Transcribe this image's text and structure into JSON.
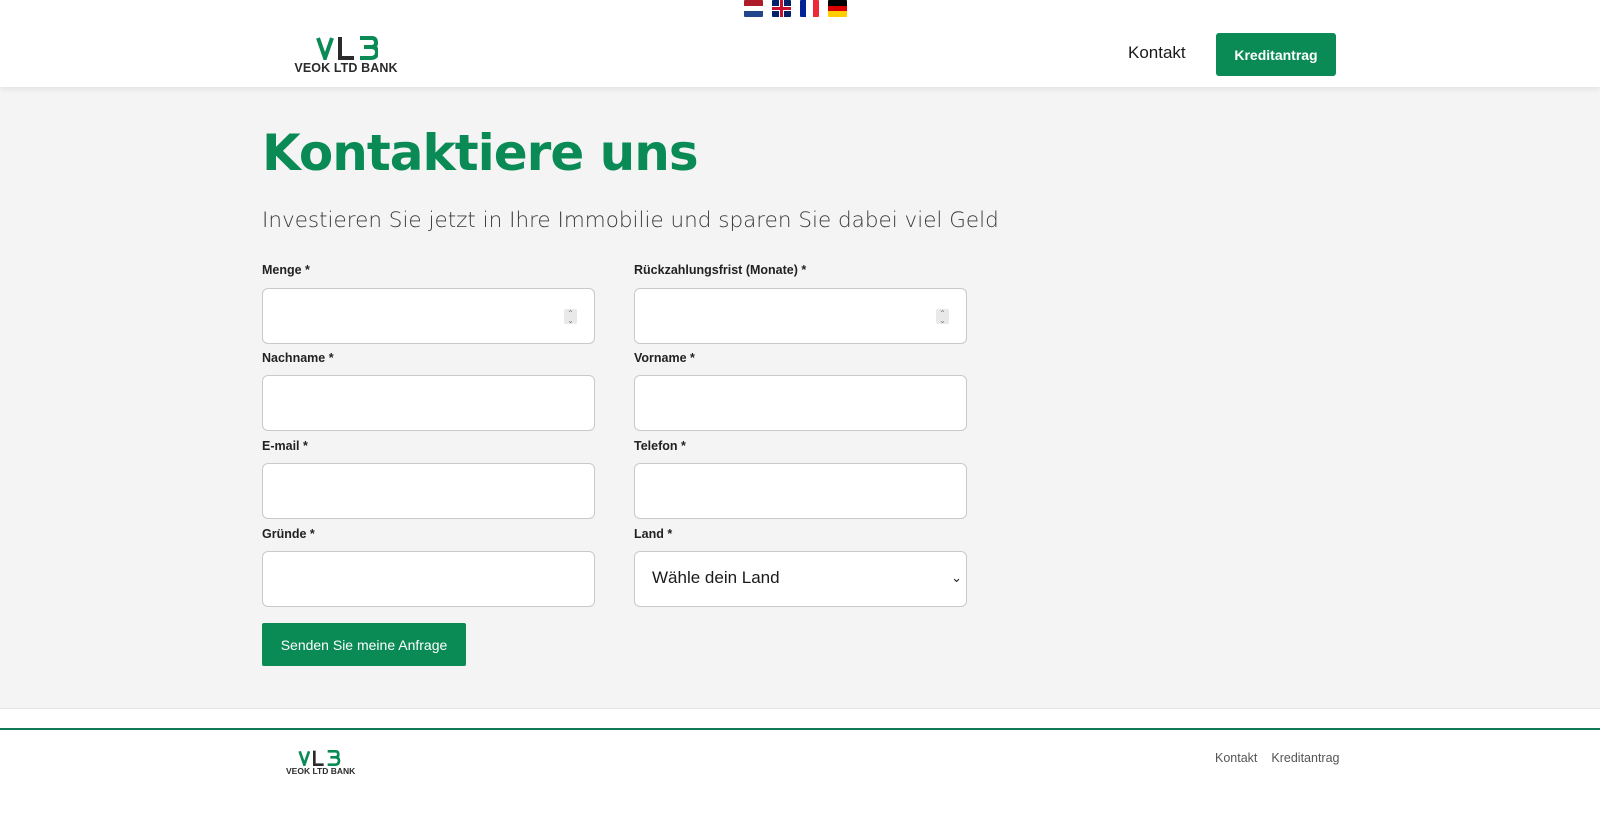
{
  "header": {
    "flags": [
      {
        "name": "flag-netherlands-icon",
        "colors": [
          "#ae1c28",
          "#ffffff",
          "#21468b"
        ]
      },
      {
        "name": "flag-uk-icon"
      },
      {
        "name": "flag-france-icon",
        "colors": [
          "#002395",
          "#ffffff",
          "#ed2939"
        ]
      },
      {
        "name": "flag-germany-icon",
        "colors": [
          "#000000",
          "#dd0000",
          "#ffce00"
        ]
      }
    ],
    "logo_name": "VEOK LTD BANK",
    "nav_contact": "Kontakt",
    "nav_button": "Kreditantrag"
  },
  "main": {
    "title": "Kontaktiere uns",
    "subtitle": "Investieren Sie jetzt in Ihre Immobilie und sparen Sie dabei viel Geld",
    "fields": {
      "amount_label": "Menge *",
      "term_label": "Rückzahlungsfrist (Monate) *",
      "lastname_label": "Nachname *",
      "firstname_label": "Vorname *",
      "email_label": "E-mail *",
      "phone_label": "Telefon *",
      "reasons_label": "Gründe *",
      "country_label": "Land *",
      "country_value": "Wähle dein Land"
    },
    "submit": "Senden Sie meine Anfrage"
  },
  "footer": {
    "logo_name": "VEOK LTD BANK",
    "links": [
      "Kontakt",
      "Kreditantrag"
    ]
  },
  "colors": {
    "brand_green": "#0a8a55",
    "background": "#f4f4f4"
  }
}
